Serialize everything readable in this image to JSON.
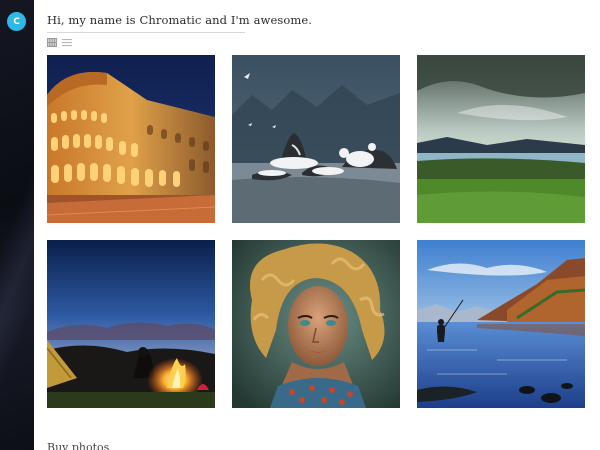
{
  "profile": {
    "avatar_letter": "C",
    "avatar_color": "#2fb8e6",
    "greeting": "Hi, my name is Chromatic and I'm awesome."
  },
  "view_toggle": {
    "grid_icon": "grid-view-icon",
    "list_icon": "list-view-icon"
  },
  "gallery": {
    "photos": [
      {
        "subject": "colosseum-at-night"
      },
      {
        "subject": "humpback-whales-breaching"
      },
      {
        "subject": "green-valley-lake"
      },
      {
        "subject": "campfire-at-dusk"
      },
      {
        "subject": "curly-haired-woman-portrait"
      },
      {
        "subject": "fisherman-on-lake"
      }
    ]
  },
  "footer": {
    "buy_link": "Buy photos"
  }
}
